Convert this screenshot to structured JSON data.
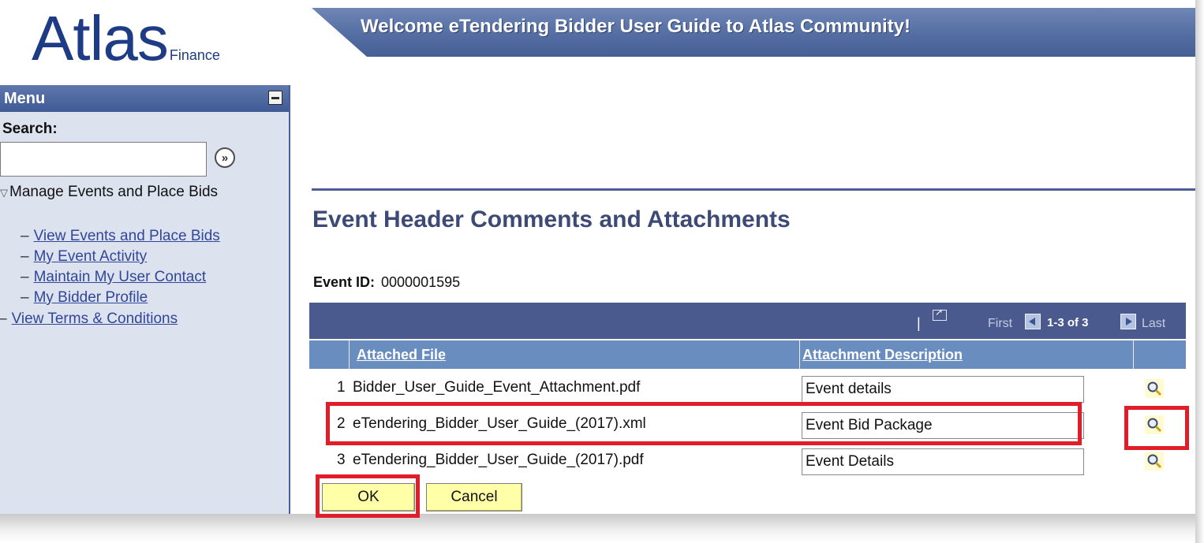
{
  "header": {
    "logo_main": "Atlas",
    "logo_sub": "Finance",
    "banner_text": "Welcome eTendering Bidder User Guide to Atlas Community!"
  },
  "menu": {
    "title": "Menu",
    "search_label": "Search:",
    "search_value": "",
    "search_go_icon": "»",
    "root_item": "Manage Events and Place Bids",
    "items": [
      {
        "label": "View Events and Place Bids"
      },
      {
        "label": "My Event Activity"
      },
      {
        "label": "Maintain My User Contact"
      },
      {
        "label": "My Bidder Profile"
      }
    ],
    "terms": "View Terms & Conditions"
  },
  "main": {
    "title": "Event Header Comments and Attachments",
    "event_id_label": "Event ID:",
    "event_id_value": "0000001595",
    "grid": {
      "nav_first": "First",
      "nav_range": "1-3 of 3",
      "nav_last": "Last",
      "col_file": "Attached File",
      "col_desc": "Attachment Description",
      "rows": [
        {
          "num": "1",
          "file": "Bidder_User_Guide_Event_Attachment.pdf",
          "desc": "Event details"
        },
        {
          "num": "2",
          "file": "eTendering_Bidder_User_Guide_(2017).xml",
          "desc": "Event Bid Package"
        },
        {
          "num": "3",
          "file": "eTendering_Bidder_User_Guide_(2017).pdf",
          "desc": "Event Details"
        }
      ]
    },
    "buttons": {
      "ok": "OK",
      "cancel": "Cancel"
    }
  },
  "colors": {
    "highlight": "#e11d2a",
    "brand": "#1e3b86",
    "grid_header": "#4a5a8e",
    "button_bg": "#ffffa8"
  }
}
